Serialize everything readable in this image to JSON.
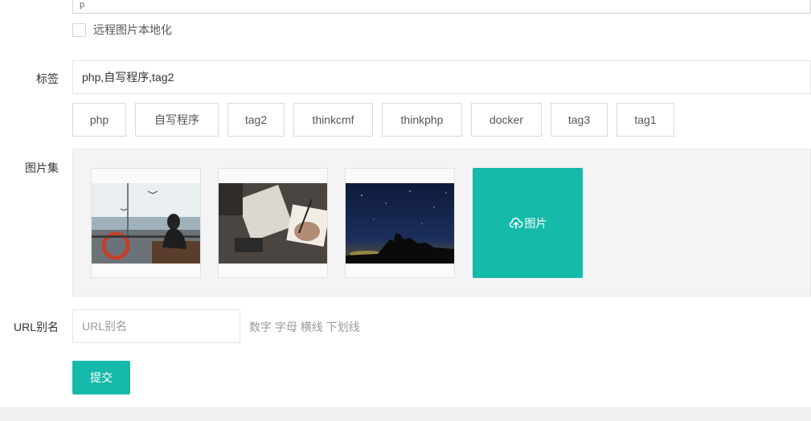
{
  "editor": {
    "status_text": "p"
  },
  "remote_local": {
    "label": "远程图片本地化"
  },
  "tags_field": {
    "label": "标签",
    "value": "php,自写程序,tag2",
    "options": [
      "php",
      "自写程序",
      "tag2",
      "thinkcmf",
      "thinkphp",
      "docker",
      "tag3",
      "tag1"
    ]
  },
  "gallery": {
    "label": "图片集",
    "upload_label": "图片",
    "upload_icon": "cloud-upload-icon"
  },
  "url_alias": {
    "label": "URL别名",
    "placeholder": "URL别名",
    "hint": "数字 字母 横线 下划线"
  },
  "submit": {
    "label": "提交"
  },
  "colors": {
    "accent": "#16baaa"
  }
}
